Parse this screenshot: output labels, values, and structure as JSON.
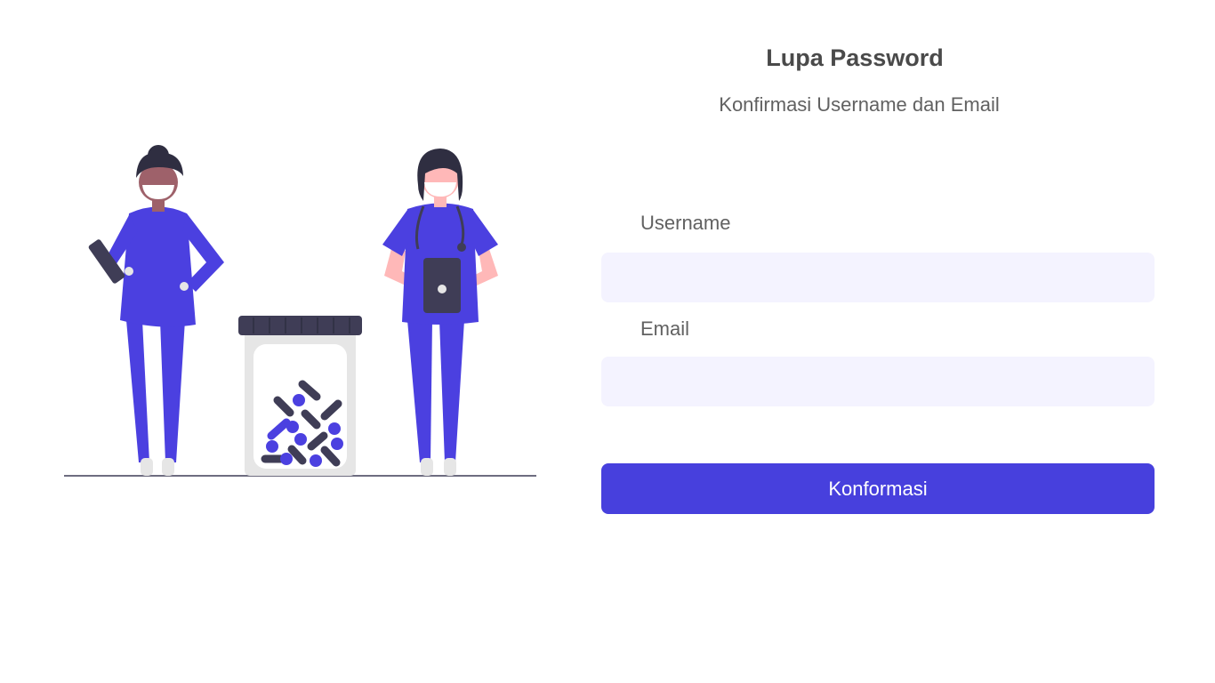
{
  "form": {
    "title": "Lupa Password",
    "subtitle": "Konfirmasi Username dan Email",
    "username_label": "Username",
    "username_value": "",
    "email_label": "Email",
    "email_value": "",
    "submit_label": "Konformasi"
  },
  "colors": {
    "accent": "#4740dd",
    "input_bg": "#f4f3ff",
    "text": "#616161",
    "dark": "#3f3d56"
  },
  "illustration": {
    "icon": "medical-staff-illustration"
  }
}
